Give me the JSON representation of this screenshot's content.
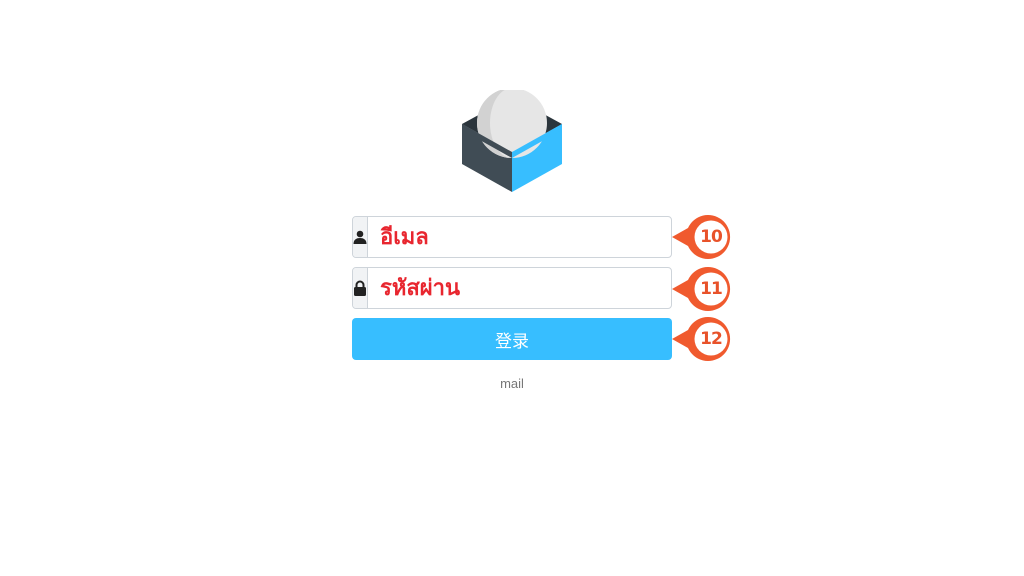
{
  "login_form": {
    "username_placeholder": "อีเมล",
    "password_placeholder": "รหัสผ่าน",
    "submit_label": "登录",
    "footer_text": "mail"
  },
  "annotations": {
    "markers": [
      "10",
      "11",
      "12"
    ]
  },
  "icons": {
    "logo": "roundcube-logo",
    "username_addon": "user-icon",
    "password_addon": "lock-icon"
  },
  "colors": {
    "accent": "#37beff",
    "label_text": "#e8262f",
    "marker": "#f05a2e",
    "logo_dark": "#404c55",
    "logo_blue": "#37beff",
    "logo_sphere": "#dcdcdc"
  }
}
